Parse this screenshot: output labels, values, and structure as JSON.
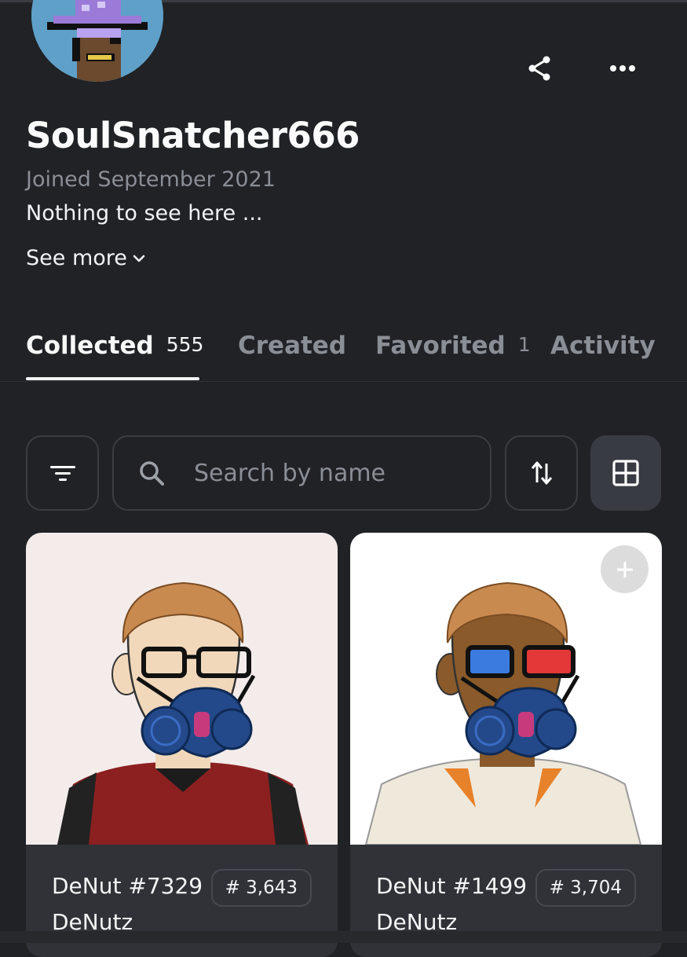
{
  "profile": {
    "username": "SoulSnatcher666",
    "joined": "Joined September 2021",
    "bio": "Nothing to see here ...",
    "see_more": "See more"
  },
  "header": {
    "share_icon": "share-icon",
    "more_icon": "more-icon"
  },
  "tabs": [
    {
      "label": "Collected",
      "count": "555",
      "active": true
    },
    {
      "label": "Created",
      "count": "",
      "active": false
    },
    {
      "label": "Favorited",
      "count": "1",
      "active": false
    },
    {
      "label": "Activity",
      "count": "",
      "active": false
    }
  ],
  "toolbar": {
    "filter_icon": "filter-icon",
    "search_placeholder": "Search by name",
    "sort_icon": "sort-icon",
    "grid_icon": "grid-view-icon"
  },
  "items": [
    {
      "name": "DeNut #7329",
      "rank": "# 3,643",
      "collection": "DeNutz",
      "background": "#f3ecea"
    },
    {
      "name": "DeNut #1499",
      "rank": "# 3,704",
      "collection": "DeNutz",
      "background": "#ffffff"
    }
  ],
  "colors": {
    "background": "#202226",
    "card_footer": "#303238",
    "muted_text": "#8a8e95",
    "accent_text": "#f2f3f5"
  }
}
